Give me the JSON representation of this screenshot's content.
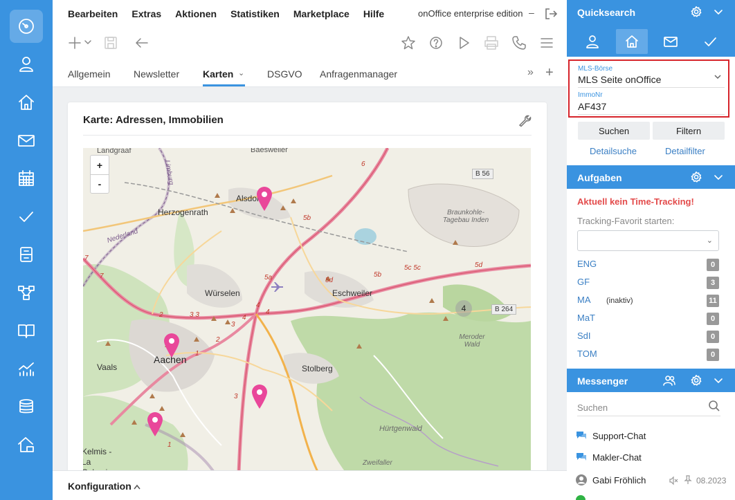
{
  "menu": {
    "items": [
      "Bearbeiten",
      "Extras",
      "Aktionen",
      "Statistiken",
      "Marketplace",
      "Hilfe"
    ],
    "edition": "onOffice enterprise edition",
    "separator": "–"
  },
  "tabs": {
    "items": [
      "Allgemein",
      "Newsletter",
      "Karten",
      "DSGVO",
      "Anfragenmanager"
    ],
    "active": "Karten",
    "more": "»",
    "add": "+"
  },
  "card": {
    "title": "Karte: Adressen, Immobilien"
  },
  "map": {
    "zoom_in": "+",
    "zoom_out": "-",
    "cluster_count": "4",
    "labels": {
      "landgraaf": "Landgraaf",
      "baesweiler": "Baesweiler",
      "alsdorf": "Alsdorf",
      "herzogenrath": "Herzogenrath",
      "wuerselen": "Würselen",
      "eschweiler": "Eschweiler",
      "aachen": "Aachen",
      "vaals": "Vaals",
      "stolberg": "Stolberg",
      "kelmis": "Kelmis - La Calamine",
      "nederland": "Nederland",
      "limburg": "Limburg",
      "braunkohle": "Braunkohle-Tagebau Inden",
      "meroder": "Meroder Wald",
      "huertgen": "Hürtgenwald",
      "zweifaller": "Zweifaller"
    },
    "shields": {
      "b56": "B 56",
      "b264": "B 264"
    },
    "roads": {
      "r6": "6",
      "r5b_a": "5b",
      "r5b_b": "5b",
      "r5c": "5c 5c",
      "r5d_a": "5d",
      "r5d_b": "5d",
      "r5a": "5a",
      "r4a": "4",
      "r4b": "4",
      "r4c": "4",
      "r3a": "3",
      "r3b": "3",
      "r33": "3 3",
      "r2a": "2",
      "r2b": "2",
      "r1a": "1",
      "r1b": "1",
      "r7a": "7",
      "r7b": "7"
    }
  },
  "config": {
    "label": "Konfiguration",
    "chevron": "^"
  },
  "quicksearch": {
    "title": "Quicksearch",
    "mls_label": "MLS-Börse",
    "mls_value": "MLS Seite onOffice",
    "immo_label": "ImmoNr",
    "immo_value": "AF437",
    "search_button": "Suchen",
    "filter_button": "Filtern",
    "detail_search": "Detailsuche",
    "detail_filter": "Detailfilter"
  },
  "tasks": {
    "title": "Aufgaben",
    "warning": "Aktuell kein Time-Tracking!",
    "tracking_label": "Tracking-Favorit starten:",
    "users": [
      {
        "code": "ENG",
        "count": "0",
        "note": ""
      },
      {
        "code": "GF",
        "count": "3",
        "note": ""
      },
      {
        "code": "MA",
        "count": "11",
        "note": "(inaktiv)"
      },
      {
        "code": "MaT",
        "count": "0",
        "note": ""
      },
      {
        "code": "SdI",
        "count": "0",
        "note": ""
      },
      {
        "code": "TOM",
        "count": "0",
        "note": ""
      }
    ]
  },
  "messenger": {
    "title": "Messenger",
    "search_placeholder": "Suchen",
    "chats": [
      "Support-Chat",
      "Makler-Chat",
      "Gabi Fröhlich"
    ],
    "gabi_date": "08.2023"
  },
  "colors": {
    "accent": "#3a93e0",
    "warning": "#e34b4b",
    "highlight_border": "#d6232a",
    "pin": "#e9479a"
  }
}
